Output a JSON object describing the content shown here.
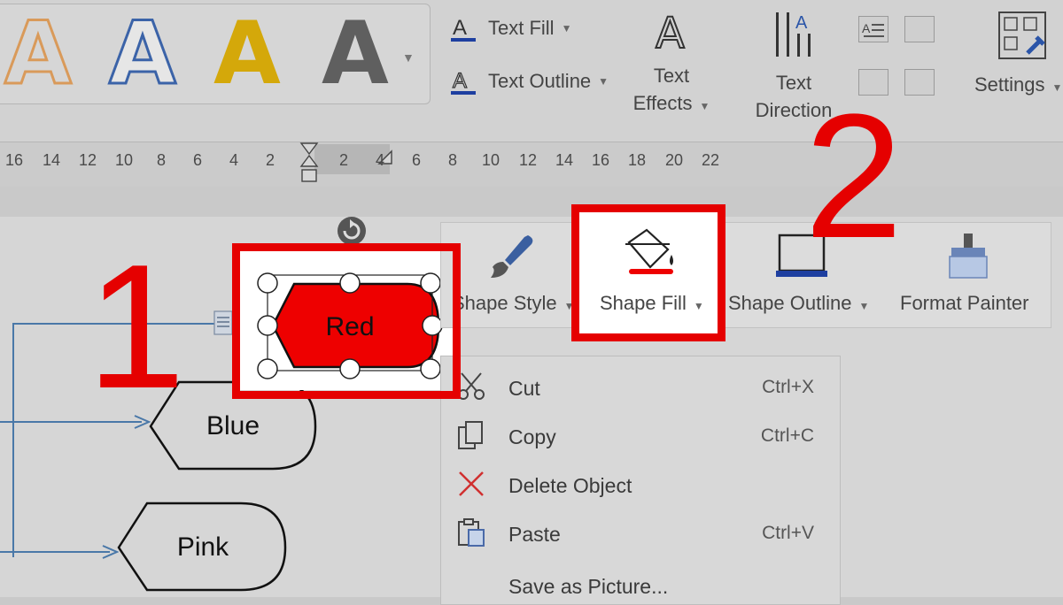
{
  "ribbon": {
    "wordart_styles": [
      {
        "letter": "A",
        "style": "orange-outline",
        "color": "#d99a5a"
      },
      {
        "letter": "A",
        "style": "blue-outline",
        "color": "#3b63a8"
      },
      {
        "letter": "A",
        "style": "gold-fill",
        "color": "#d4a80a"
      },
      {
        "letter": "A",
        "style": "gray-gradient",
        "color": "#6a6a6a"
      }
    ],
    "text_fill_label": "Text Fill",
    "text_outline_label": "Text Outline",
    "text_effects_line1": "Text",
    "text_effects_line2": "Effects",
    "text_direction_line1": "Text",
    "text_direction_line2": "Direction",
    "settings_label": "Settings"
  },
  "ruler": {
    "ticks": [
      "16",
      "14",
      "12",
      "10",
      "8",
      "6",
      "4",
      "2",
      "2",
      "4",
      "6",
      "8",
      "10",
      "12",
      "14",
      "16",
      "18",
      "20",
      "22"
    ]
  },
  "canvas": {
    "shapes": [
      {
        "label": "Red",
        "selected": true,
        "fill": "#ee0000"
      },
      {
        "label": "Blue",
        "selected": false
      },
      {
        "label": "Pink",
        "selected": false
      }
    ]
  },
  "floating_toolbar": {
    "shape_style_label": "Shape Style",
    "shape_fill_label": "Shape Fill",
    "shape_outline_label": "Shape Outline",
    "format_painter_label": "Format Painter"
  },
  "context_menu": {
    "items": [
      {
        "label": "Cut",
        "shortcut": "Ctrl+X",
        "icon": "scissors-icon"
      },
      {
        "label": "Copy",
        "shortcut": "Ctrl+C",
        "icon": "copy-icon"
      },
      {
        "label": "Delete Object",
        "shortcut": "",
        "icon": "delete-icon"
      },
      {
        "label": "Paste",
        "shortcut": "Ctrl+V",
        "icon": "paste-icon"
      },
      {
        "label": "Save as Picture...",
        "shortcut": "",
        "icon": ""
      }
    ]
  },
  "annotations": {
    "step1": "1",
    "step2": "2",
    "highlight_color": "#e50000"
  }
}
